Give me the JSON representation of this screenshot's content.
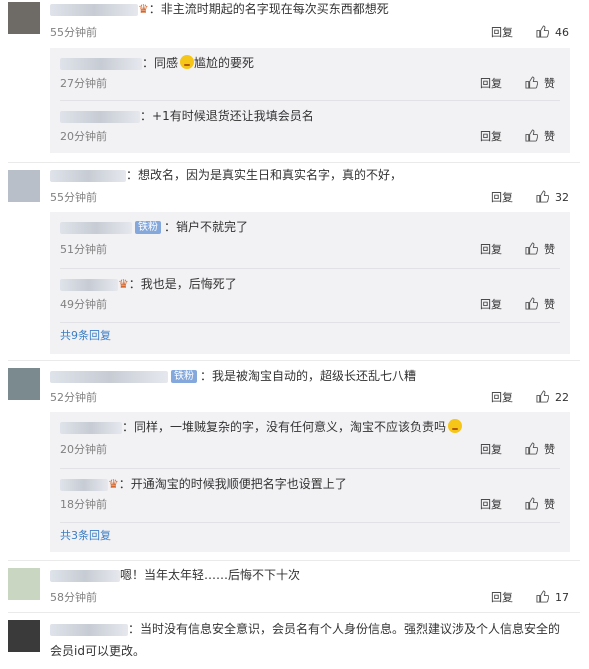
{
  "actions": {
    "reply": "回复",
    "like": "赞"
  },
  "comments": [
    {
      "text": "非主流时期起的名字现在每次买东西都想死",
      "time": "55分钟前",
      "likes": "46",
      "replies": [
        {
          "text": "同感",
          "text2": "尴尬的要死",
          "time": "27分钟前"
        },
        {
          "text": "+1有时候退货还让我填会员名",
          "time": "20分钟前"
        }
      ]
    },
    {
      "text": "想改名，因为是真实生日和真实名字，真的不好，",
      "time": "55分钟前",
      "likes": "32",
      "replies": [
        {
          "badge": "铁粉",
          "text": "销户不就完了",
          "time": "51分钟前"
        },
        {
          "text": "我也是，后悔死了",
          "time": "49分钟前"
        }
      ],
      "more": "共9条回复"
    },
    {
      "badge": "铁粉",
      "text": "我是被淘宝自动的，超级长还乱七八糟",
      "time": "52分钟前",
      "likes": "22",
      "replies": [
        {
          "text": "同样，一堆贼复杂的字，没有任何意义，淘宝不应该负责吗",
          "time": "20分钟前"
        },
        {
          "text": "开通淘宝的时候我顺便把名字也设置上了",
          "time": "18分钟前"
        }
      ],
      "more": "共3条回复"
    },
    {
      "text": "嗯！当年太年轻……后悔不下十次",
      "time": "58分钟前",
      "likes": "17"
    },
    {
      "text": "当时没有信息安全意识，会员名有个人身份信息。强烈建议涉及个人信息安全的",
      "text_line2": "会员id可以更改。"
    }
  ],
  "icons": {
    "like": "thumbs-up-icon",
    "badge_emoji": "crown-emoji-icon",
    "emoji": "awkward-face-emoji"
  },
  "colors": {
    "link": "#3b7dc4",
    "time": "#808080",
    "sub_bg": "#f2f2f5",
    "badge": "#84a8db"
  }
}
